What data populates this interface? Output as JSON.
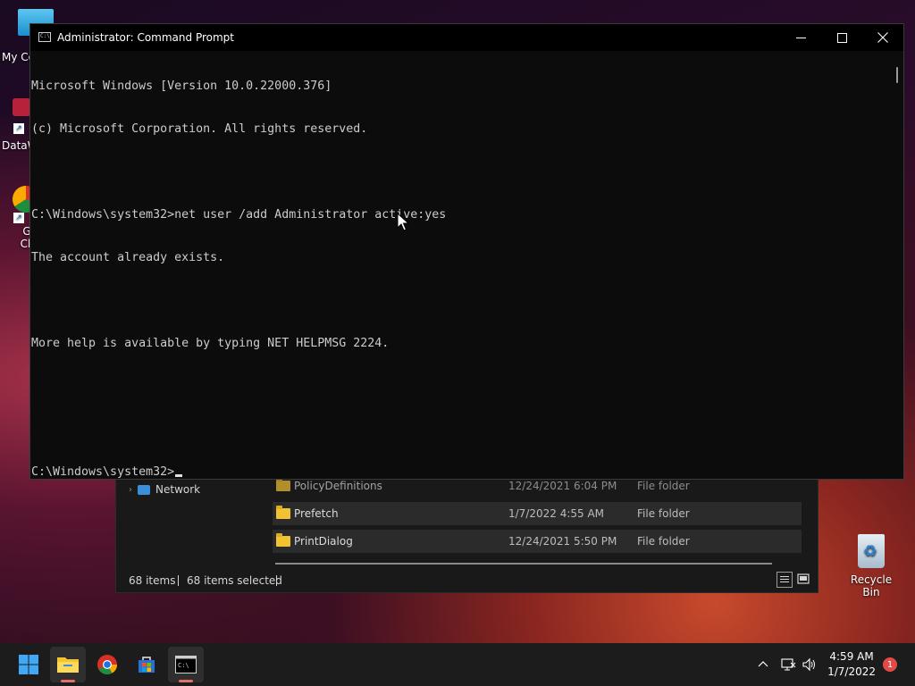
{
  "desktop": {
    "icons": [
      {
        "label": "My Co"
      },
      {
        "label": "DataW"
      },
      {
        "label": "Go\nChi"
      },
      {
        "label": "Recycle Bin"
      }
    ]
  },
  "cmd_window": {
    "title": "Administrator: Command Prompt",
    "lines": [
      "Microsoft Windows [Version 10.0.22000.376]",
      "(c) Microsoft Corporation. All rights reserved.",
      "",
      "C:\\Windows\\system32>net user /add Administrator active:yes",
      "The account already exists.",
      "",
      "More help is available by typing NET HELPMSG 2224.",
      "",
      "",
      "C:\\Windows\\system32>"
    ],
    "buttons": {
      "minimize": "—",
      "maximize": "☐",
      "close": "✕"
    }
  },
  "explorer": {
    "nav_item": "Network",
    "rows": [
      {
        "name": "PolicyDefinitions",
        "date": "12/24/2021 6:04 PM",
        "type": "File folder"
      },
      {
        "name": "Prefetch",
        "date": "1/7/2022 4:55 AM",
        "type": "File folder"
      },
      {
        "name": "PrintDialog",
        "date": "12/24/2021 5:50 PM",
        "type": "File folder"
      }
    ],
    "status": {
      "items": "68 items",
      "selected": "68 items selected"
    }
  },
  "taskbar": {
    "apps": [
      "start-icon",
      "file-explorer-icon",
      "chrome-icon",
      "store-icon",
      "terminal-icon"
    ],
    "clock": {
      "time": "4:59 AM",
      "date": "1/7/2022"
    },
    "notification_count": "1"
  }
}
